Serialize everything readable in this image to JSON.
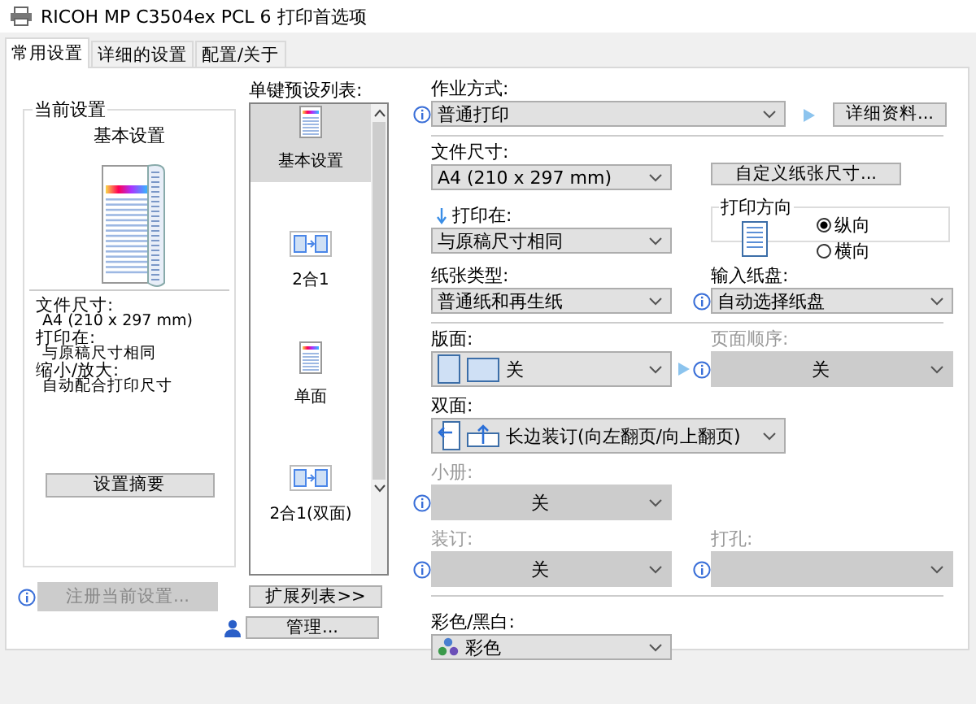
{
  "window": {
    "title": "RICOH MP C3504ex PCL 6 打印首选项"
  },
  "tabs": [
    {
      "label": "常用设置",
      "selected": true
    },
    {
      "label": "详细的设置",
      "selected": false
    },
    {
      "label": "配置/关于",
      "selected": false
    }
  ],
  "current_settings": {
    "title": "当前设置",
    "preset": "基本设置",
    "details": [
      {
        "label": "文件尺寸:",
        "value": "A4 (210 x 297 mm)"
      },
      {
        "label": "打印在:",
        "value": "与原稿尺寸相同"
      },
      {
        "label": "缩小/放大:",
        "value": "自动配合打印尺寸"
      }
    ],
    "summary_button": "设置摘要",
    "register_button": {
      "label": "注册当前设置...",
      "disabled": true
    }
  },
  "presets": {
    "label": "单键预设列表:",
    "items": [
      {
        "label": "基本设置",
        "selected": true,
        "kind": "document"
      },
      {
        "label": "2合1",
        "selected": false,
        "kind": "combine"
      },
      {
        "label": "单面",
        "selected": false,
        "kind": "document"
      },
      {
        "label": "2合1(双面)",
        "selected": false,
        "kind": "combine"
      }
    ],
    "expand_button": "扩展列表>>",
    "manage_button": "管理..."
  },
  "job_type": {
    "label": "作业方式:",
    "value": "普通打印",
    "disabled": false,
    "details_button": "详细资料..."
  },
  "document_size": {
    "label": "文件尺寸:",
    "value": "A4 (210 x 297 mm)",
    "disabled": false,
    "custom_button": "自定义纸张尺寸..."
  },
  "print_on": {
    "label": "打印在:",
    "value": "与原稿尺寸相同",
    "disabled": false
  },
  "orientation": {
    "title": "打印方向",
    "options": [
      {
        "label": "纵向",
        "selected": true
      },
      {
        "label": "横向",
        "selected": false
      }
    ]
  },
  "paper_type": {
    "label": "纸张类型:",
    "value": "普通纸和再生纸",
    "disabled": false
  },
  "input_tray": {
    "label": "输入纸盘:",
    "value": "自动选择纸盘",
    "disabled": false
  },
  "layout": {
    "label": "版面:",
    "value": "关",
    "disabled": false
  },
  "page_order": {
    "label": "页面顺序:",
    "value": "关",
    "disabled": true
  },
  "duplex": {
    "label": "双面:",
    "value": "长边装订(向左翻页/向上翻页)",
    "disabled": false
  },
  "booklet": {
    "label": "小册:",
    "value": "关",
    "disabled": true
  },
  "staple": {
    "label": "装订:",
    "value": "关",
    "disabled": true
  },
  "punch": {
    "label": "打孔:",
    "disabled": true
  },
  "color_mode": {
    "label": "彩色/黑白:",
    "value": "彩色",
    "disabled": false
  }
}
